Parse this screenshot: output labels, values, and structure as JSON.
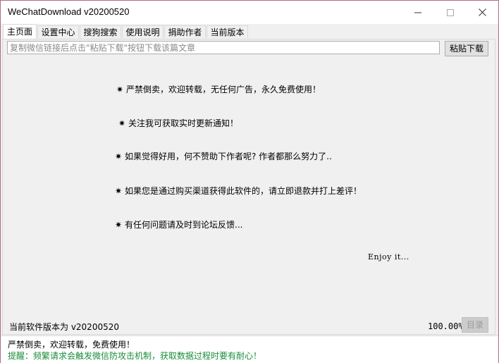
{
  "window": {
    "title": "WeChatDownload v20200520",
    "border_color": "#b06a88"
  },
  "controls": {
    "minimize_icon": "minimize-icon",
    "maximize_icon": "maximize-icon",
    "close_icon": "close-icon"
  },
  "tabs": [
    {
      "label": "主页面",
      "active": true
    },
    {
      "label": "设置中心",
      "active": false
    },
    {
      "label": "搜狗搜索",
      "active": false
    },
    {
      "label": "使用说明",
      "active": false
    },
    {
      "label": "捐助作者",
      "active": false
    },
    {
      "label": "当前版本",
      "active": false
    }
  ],
  "main": {
    "url_placeholder": "复制微信链接后点击\"粘贴下载\"按钮下载该篇文章",
    "paste_button": "粘贴下载",
    "star_glyph": "✷",
    "notes": [
      "严禁倒卖，欢迎转载，无任何广告，永久免费使用！",
      "关注我可获取实时更新通知！",
      "如果觉得好用，何不赞助下作者呢? 作者都那么努力了..",
      "如果您是通过购买渠道获得此软件的，请立即退款并打上差评！",
      "有任何问题请及时到论坛反馈..."
    ],
    "enjoy": "Enjoy it...",
    "version_text": "当前软件版本为 v20200520",
    "progress_text": "100.00%",
    "dir_button": "目录"
  },
  "status": {
    "line1": "严禁倒卖，欢迎转载，免费使用！",
    "line2": "提醒：频繁请求会触发微信防攻击机制，获取数据过程时要有耐心！",
    "line2_color": "#1a8c3a"
  }
}
